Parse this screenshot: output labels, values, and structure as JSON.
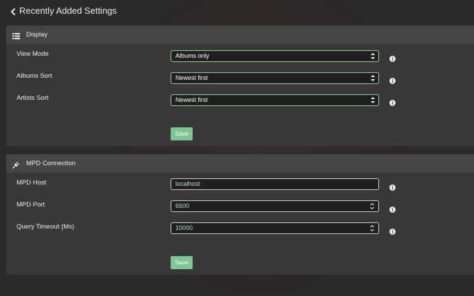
{
  "header": {
    "title": "Recently Added Settings",
    "back_icon": "chevron-left-icon"
  },
  "display": {
    "title": "Display",
    "icon": "list-icon",
    "rows": [
      {
        "label": "View Mode",
        "value": "Albums only"
      },
      {
        "label": "Albums Sort",
        "value": "Newest first"
      },
      {
        "label": "Artists Sort",
        "value": "Newest first"
      }
    ],
    "save_label": "Save"
  },
  "mpd": {
    "title": "MPD Connection",
    "icon": "plug-icon",
    "rows": [
      {
        "label": "MPD Host",
        "value": "localhost"
      },
      {
        "label": "MPD Port",
        "value": "6600"
      },
      {
        "label": "Query Timeout (Ms)",
        "value": "10000"
      }
    ],
    "save_label": "Save"
  },
  "colors": {
    "accent": "#7cc791",
    "select_border": "#8fd3a1",
    "panel": "#3a3a3a",
    "background": "#2b2b2b"
  }
}
